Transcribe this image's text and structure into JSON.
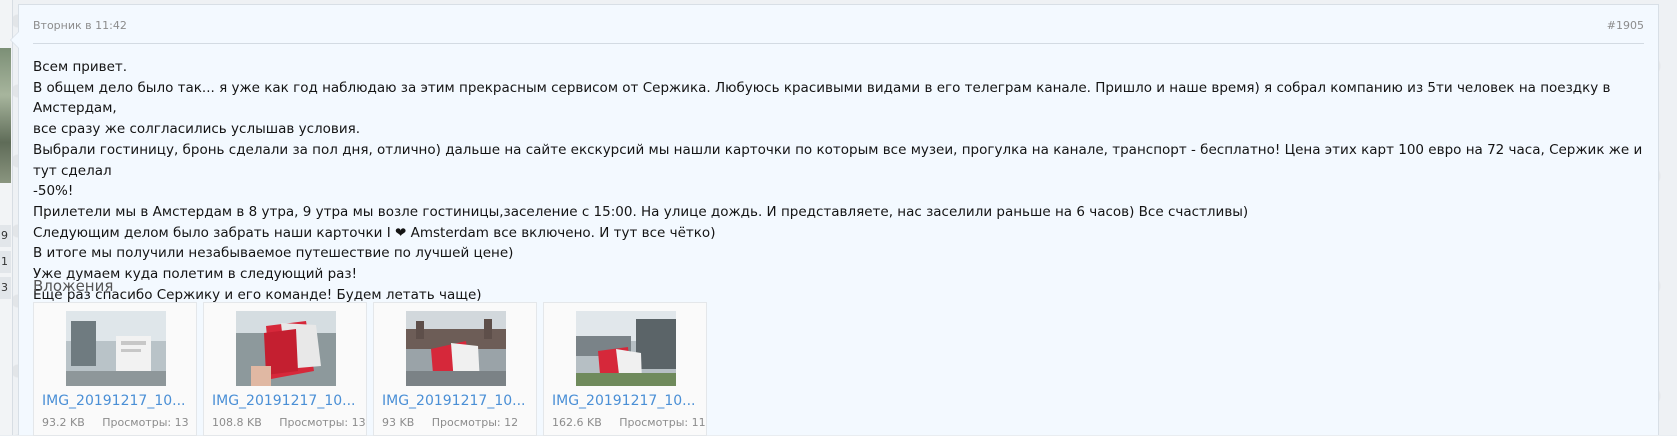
{
  "post": {
    "date": "Вторник в 11:42",
    "number": "#1905",
    "lines": [
      "Всем привет.",
      "В общем дело было так... я уже как год наблюдаю за этим прекрасным сервисом от Сержика. Любуюсь красивыми видами в его телеграм канале. Пришло и наше время) я собрал компанию из 5ти человек на поездку в Амстердам,",
      "все сразу же солгласились услышав условия.",
      "Выбрали гостиницу, бронь сделали за пол дня, отлично) дальше на сайте екскурсий мы нашли карточки по которым все музеи, прогулка на канале, транспорт - бесплатно! Цена этих карт 100 евро на 72 часа, Сержик же и тут сделал",
      "-50%!",
      "Прилетели мы в Амстердам в 8 утра, 9 утра мы возле гостиницы,заселение с 15:00. На улице дождь. И представляете, нас заселили раньше на 6 часов) Все счастливы)",
      "Следующим делом было забрать наши карточки I ❤ Amsterdam все включено. И тут все чётко)",
      "В итоге мы получили незабываемое путешествие по лучшей цене)",
      "Уже думаем куда полетим в следующий раз!",
      "Еще раз спасибо Сержику и его команде! Будем летать чаще)"
    ]
  },
  "sidebar_numbers": [
    "9",
    "1",
    "3"
  ],
  "attachments": {
    "title": "Вложения",
    "items": [
      {
        "name": "IMG_20191217_10...",
        "size": "93.2 KB",
        "views": "Просмотры: 13"
      },
      {
        "name": "IMG_20191217_10...",
        "size": "108.8 KB",
        "views": "Просмотры: 13"
      },
      {
        "name": "IMG_20191217_10...",
        "size": "93 KB",
        "views": "Просмотры: 12"
      },
      {
        "name": "IMG_20191217_10...",
        "size": "162.6 KB",
        "views": "Просмотры: 11"
      }
    ]
  },
  "colors": {
    "card_bg": "#f3f9ff",
    "link": "#4a8fd6",
    "muted": "#8c8c8c"
  }
}
